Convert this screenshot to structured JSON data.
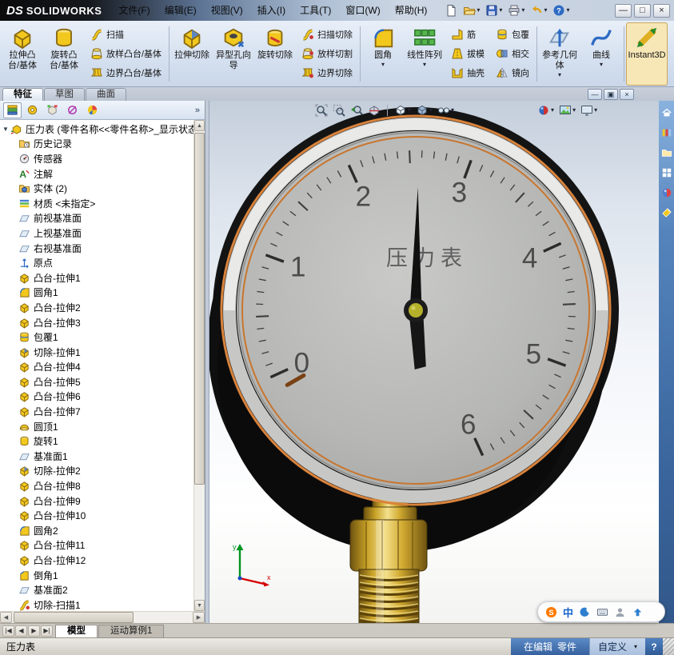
{
  "glyphs": {
    "caret": "▾",
    "chevron": "»",
    "scroll_up": "▲",
    "scroll_down": "▼",
    "scroll_left": "◀",
    "scroll_right": "▶",
    "root_caret": "▼"
  },
  "titlebar": {
    "logo_ds": "DS",
    "logo_name": "SOLIDWORKS",
    "menus": [
      "文件(F)",
      "编辑(E)",
      "视图(V)",
      "插入(I)",
      "工具(T)",
      "窗口(W)",
      "帮助(H)"
    ],
    "quick_tools": [
      {
        "icon": "new-document",
        "caret": false
      },
      {
        "icon": "open-folder",
        "caret": true
      },
      {
        "icon": "save",
        "caret": true
      },
      {
        "icon": "print",
        "caret": true
      },
      {
        "icon": "undo",
        "caret": true
      },
      {
        "icon": "help",
        "caret": true
      }
    ],
    "window_controls": [
      {
        "name": "minimize",
        "glyph": "—"
      },
      {
        "name": "maximize",
        "glyph": "□"
      },
      {
        "name": "close",
        "glyph": "×"
      }
    ]
  },
  "ribbon": {
    "buttons": [
      {
        "type": "large",
        "icon": "extrude-boss",
        "label": "拉伸凸台/基体"
      },
      {
        "type": "large",
        "icon": "revolve-boss",
        "label": "旋转凸台/基体"
      },
      {
        "type": "stack",
        "items": [
          {
            "icon": "sweep",
            "label": "扫描"
          },
          {
            "icon": "loft",
            "label": "放样凸台/基体"
          },
          {
            "icon": "boundary",
            "label": "边界凸台/基体"
          }
        ]
      },
      {
        "type": "sep"
      },
      {
        "type": "large",
        "icon": "extrude-cut",
        "label": "拉伸切除"
      },
      {
        "type": "large",
        "icon": "hole-wizard",
        "label": "异型孔向导"
      },
      {
        "type": "large",
        "icon": "revolve-cut",
        "label": "旋转切除"
      },
      {
        "type": "stack",
        "items": [
          {
            "icon": "sweep-cut",
            "label": "扫描切除"
          },
          {
            "icon": "loft-cut",
            "label": "放样切割"
          },
          {
            "icon": "boundary-cut",
            "label": "边界切除"
          }
        ]
      },
      {
        "type": "sep"
      },
      {
        "type": "large",
        "icon": "fillet",
        "label": "圆角",
        "caret": true
      },
      {
        "type": "large",
        "icon": "linear-pattern",
        "label": "线性阵列",
        "caret": true
      },
      {
        "type": "stack",
        "items": [
          {
            "icon": "rib",
            "label": "筋"
          },
          {
            "icon": "draft",
            "label": "拔模"
          },
          {
            "icon": "shell",
            "label": "抽壳"
          }
        ]
      },
      {
        "type": "stack",
        "items": [
          {
            "icon": "wrap",
            "label": "包覆"
          },
          {
            "icon": "intersect",
            "label": "相交"
          },
          {
            "icon": "mirror",
            "label": "镜向"
          }
        ]
      },
      {
        "type": "sep"
      },
      {
        "type": "large",
        "icon": "ref-geometry",
        "label": "参考几何体",
        "caret": true
      },
      {
        "type": "large",
        "icon": "curves",
        "label": "曲线",
        "caret": true
      },
      {
        "type": "sep"
      },
      {
        "type": "large",
        "icon": "instant3d",
        "label": "Instant3D",
        "pressed": true,
        "one_line": true
      }
    ]
  },
  "command_tabs": [
    {
      "label": "特征",
      "active": true
    },
    {
      "label": "草图",
      "active": false
    },
    {
      "label": "曲面",
      "active": false
    }
  ],
  "doc_controls": [
    {
      "name": "doc-minimize",
      "glyph": "—"
    },
    {
      "name": "doc-restore",
      "glyph": "▣"
    },
    {
      "name": "doc-close",
      "glyph": "×"
    }
  ],
  "panel": {
    "tabs": [
      {
        "icon": "featuremanager-tab",
        "active": true
      },
      {
        "icon": "propertymanager-tab",
        "active": false
      },
      {
        "icon": "configurationmanager-tab",
        "active": false
      },
      {
        "icon": "dimxpertmanager-tab",
        "active": false
      },
      {
        "icon": "displaymanager-tab",
        "active": false
      }
    ],
    "root": {
      "icon": "part-root",
      "label": "压力表 (零件名称<<零件名称>_显示状态"
    },
    "items": [
      {
        "label": "历史记录",
        "icon": "folder-history"
      },
      {
        "label": "传感器",
        "icon": "sensors"
      },
      {
        "label": "注解",
        "icon": "annotations"
      },
      {
        "label": "实体 (2)",
        "icon": "solids-folder"
      },
      {
        "label": "材质 <未指定>",
        "icon": "material"
      },
      {
        "label": "前视基准面",
        "icon": "plane"
      },
      {
        "label": "上视基准面",
        "icon": "plane"
      },
      {
        "label": "右视基准面",
        "icon": "plane"
      },
      {
        "label": "原点",
        "icon": "origin"
      },
      {
        "label": "凸台-拉伸1",
        "icon": "extrude-boss"
      },
      {
        "label": "圆角1",
        "icon": "fillet"
      },
      {
        "label": "凸台-拉伸2",
        "icon": "extrude-boss"
      },
      {
        "label": "凸台-拉伸3",
        "icon": "extrude-boss"
      },
      {
        "label": "包覆1",
        "icon": "wrap"
      },
      {
        "label": "切除-拉伸1",
        "icon": "extrude-cut"
      },
      {
        "label": "凸台-拉伸4",
        "icon": "extrude-boss"
      },
      {
        "label": "凸台-拉伸5",
        "icon": "extrude-boss"
      },
      {
        "label": "凸台-拉伸6",
        "icon": "extrude-boss"
      },
      {
        "label": "凸台-拉伸7",
        "icon": "extrude-boss"
      },
      {
        "label": "圆顶1",
        "icon": "dome"
      },
      {
        "label": "旋转1",
        "icon": "revolve-boss"
      },
      {
        "label": "基准面1",
        "icon": "plane"
      },
      {
        "label": "切除-拉伸2",
        "icon": "extrude-cut"
      },
      {
        "label": "凸台-拉伸8",
        "icon": "extrude-boss"
      },
      {
        "label": "凸台-拉伸9",
        "icon": "extrude-boss"
      },
      {
        "label": "凸台-拉伸10",
        "icon": "extrude-boss"
      },
      {
        "label": "圆角2",
        "icon": "fillet"
      },
      {
        "label": "凸台-拉伸11",
        "icon": "extrude-boss"
      },
      {
        "label": "凸台-拉伸12",
        "icon": "extrude-boss"
      },
      {
        "label": "倒角1",
        "icon": "chamfer"
      },
      {
        "label": "基准面2",
        "icon": "plane"
      },
      {
        "label": "切除-扫描1",
        "icon": "sweep-cut"
      }
    ]
  },
  "viewport": {
    "headsup": [
      {
        "icon": "zoom-fit"
      },
      {
        "icon": "zoom-area"
      },
      {
        "icon": "zoom-previous"
      },
      {
        "icon": "section-view"
      },
      {
        "sep": true
      },
      {
        "icon": "view-orientation",
        "caret": true
      },
      {
        "icon": "display-style",
        "caret": true
      },
      {
        "icon": "hide-show-items",
        "caret": true
      },
      {
        "spacer": 96
      },
      {
        "icon": "edit-appearance",
        "caret": true
      },
      {
        "icon": "apply-scene",
        "caret": true
      },
      {
        "icon": "view-settings",
        "caret": true
      }
    ],
    "gauge": {
      "title": "压力表",
      "min": 0,
      "max": 6,
      "value": 2.55,
      "labels": [
        "0",
        "1",
        "2",
        "3",
        "4",
        "5",
        "6"
      ]
    },
    "triad": {
      "x": "x",
      "y": "y"
    }
  },
  "taskpane": {
    "icons": [
      "sw-resources",
      "design-library",
      "file-explorer",
      "view-palette-pane",
      "appearances-pane",
      "custom-properties"
    ]
  },
  "bottom": {
    "nav": [
      "|◀",
      "◀",
      "▶",
      "▶|"
    ],
    "tabs": [
      {
        "label": "模型",
        "active": true
      },
      {
        "label": "运动算例1",
        "active": false
      }
    ]
  },
  "statusbar": {
    "left": "压力表",
    "mode": "在编辑",
    "doc_type": "零件",
    "custom": "自定义",
    "help": "?"
  },
  "tray": {
    "mode_label": "中",
    "icons": [
      "sogou-logo",
      "chinese-mode",
      "half-moon",
      "soft-keyboard",
      "user",
      "skin-up"
    ]
  }
}
